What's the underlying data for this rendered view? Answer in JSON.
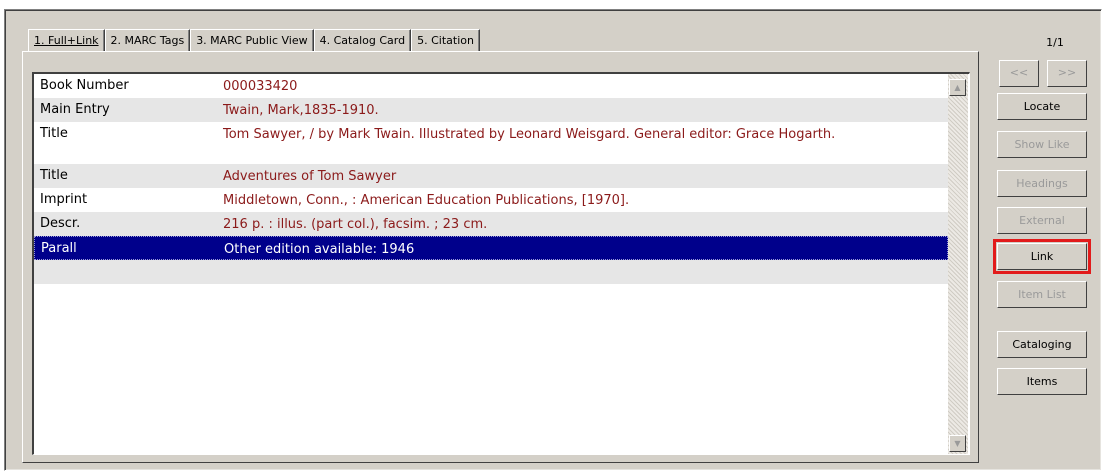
{
  "tabs": [
    {
      "label": "1. Full+Link",
      "active": true
    },
    {
      "label": "2. MARC Tags",
      "active": false
    },
    {
      "label": "3. MARC Public View",
      "active": false
    },
    {
      "label": "4. Catalog Card",
      "active": false
    },
    {
      "label": "5. Citation",
      "active": false
    }
  ],
  "record": {
    "rows": [
      {
        "label": "Book Number",
        "value": "000033420"
      },
      {
        "label": "Main Entry",
        "value": "Twain, Mark,1835-1910."
      },
      {
        "label": "Title",
        "value": "Tom Sawyer, / by Mark Twain. Illustrated by Leonard Weisgard. General editor: Grace Hogarth."
      },
      {
        "label": "Title",
        "value": "Adventures of Tom Sawyer"
      },
      {
        "label": "Imprint",
        "value": "Middletown, Conn., : American Education Publications, [1970]."
      },
      {
        "label": "Descr.",
        "value": "216 p. :  illus. (part col.), facsim. ;  23 cm."
      },
      {
        "label": "Parall",
        "value": "Other edition available: 1946"
      }
    ],
    "selected_row": "Parall"
  },
  "navigation": {
    "counter": "1/1",
    "prev_label": "<<",
    "next_label": ">>"
  },
  "side_buttons": {
    "locate": "Locate",
    "show_like": "Show Like",
    "headings": "Headings",
    "external": "External",
    "link": "Link",
    "item_list": "Item List",
    "cataloging": "Cataloging",
    "items": "Items"
  },
  "scrollbar": {
    "up_icon": "scroll-up-arrow",
    "down_icon": "scroll-down-arrow"
  },
  "colors": {
    "value_text": "#8b1a1a",
    "selection": "#00008b",
    "highlight_outline": "#e21b1b"
  }
}
